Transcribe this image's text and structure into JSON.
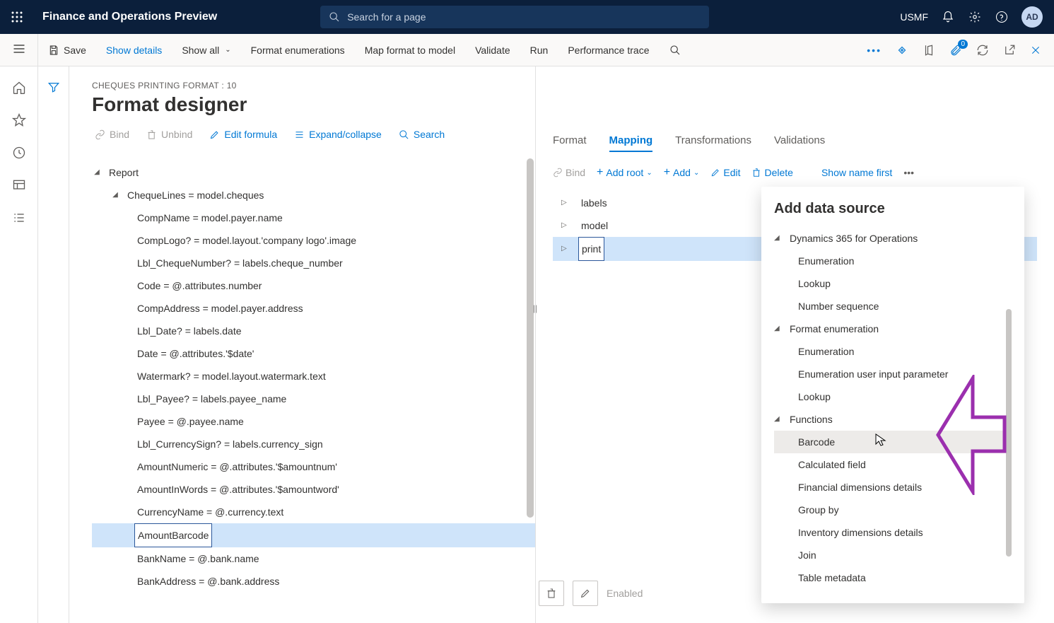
{
  "topbar": {
    "title": "Finance and Operations Preview",
    "search_placeholder": "Search for a page",
    "company": "USMF",
    "avatar": "AD"
  },
  "actionbar": {
    "save": "Save",
    "show_details": "Show details",
    "show_all": "Show all",
    "format_enum": "Format enumerations",
    "map_format": "Map format to model",
    "validate": "Validate",
    "run": "Run",
    "perf_trace": "Performance trace",
    "attach_badge": "0"
  },
  "page": {
    "crumb": "CHEQUES PRINTING FORMAT : 10",
    "title": "Format designer"
  },
  "format_toolbar": {
    "bind": "Bind",
    "unbind": "Unbind",
    "edit_formula": "Edit formula",
    "expand": "Expand/collapse",
    "search": "Search"
  },
  "tree": {
    "root": "Report",
    "cheque_lines": "ChequeLines = model.cheques",
    "items": [
      "CompName = model.payer.name",
      "CompLogo? = model.layout.'company logo'.image",
      "Lbl_ChequeNumber? = labels.cheque_number",
      "Code = @.attributes.number",
      "CompAddress = model.payer.address",
      "Lbl_Date? = labels.date",
      "Date = @.attributes.'$date'",
      "Watermark? = model.layout.watermark.text",
      "Lbl_Payee? = labels.payee_name",
      "Payee = @.payee.name",
      "Lbl_CurrencySign? = labels.currency_sign",
      "AmountNumeric = @.attributes.'$amountnum'",
      "AmountInWords = @.attributes.'$amountword'",
      "CurrencyName = @.currency.text",
      "AmountBarcode",
      "BankName = @.bank.name",
      "BankAddress = @.bank.address"
    ],
    "selected_index": 14
  },
  "map_tabs": [
    "Format",
    "Mapping",
    "Transformations",
    "Validations"
  ],
  "map_tabs_active": 1,
  "map_toolbar": {
    "bind": "Bind",
    "add_root": "Add root",
    "add": "Add",
    "edit": "Edit",
    "delete": "Delete",
    "show_name_first": "Show name first"
  },
  "ds_tree": {
    "items": [
      "labels",
      "model",
      "print"
    ],
    "selected_index": 2
  },
  "bottom": {
    "enabled": "Enabled"
  },
  "popover": {
    "title": "Add data source",
    "groups": [
      {
        "label": "Dynamics 365 for Operations",
        "items": [
          "Enumeration",
          "Lookup",
          "Number sequence"
        ]
      },
      {
        "label": "Format enumeration",
        "items": [
          "Enumeration",
          "Enumeration user input parameter",
          "Lookup"
        ]
      },
      {
        "label": "Functions",
        "items": [
          "Barcode",
          "Calculated field",
          "Financial dimensions details",
          "Group by",
          "Inventory dimensions details",
          "Join",
          "Table metadata"
        ]
      }
    ],
    "hover_group": 2,
    "hover_item": 0
  }
}
